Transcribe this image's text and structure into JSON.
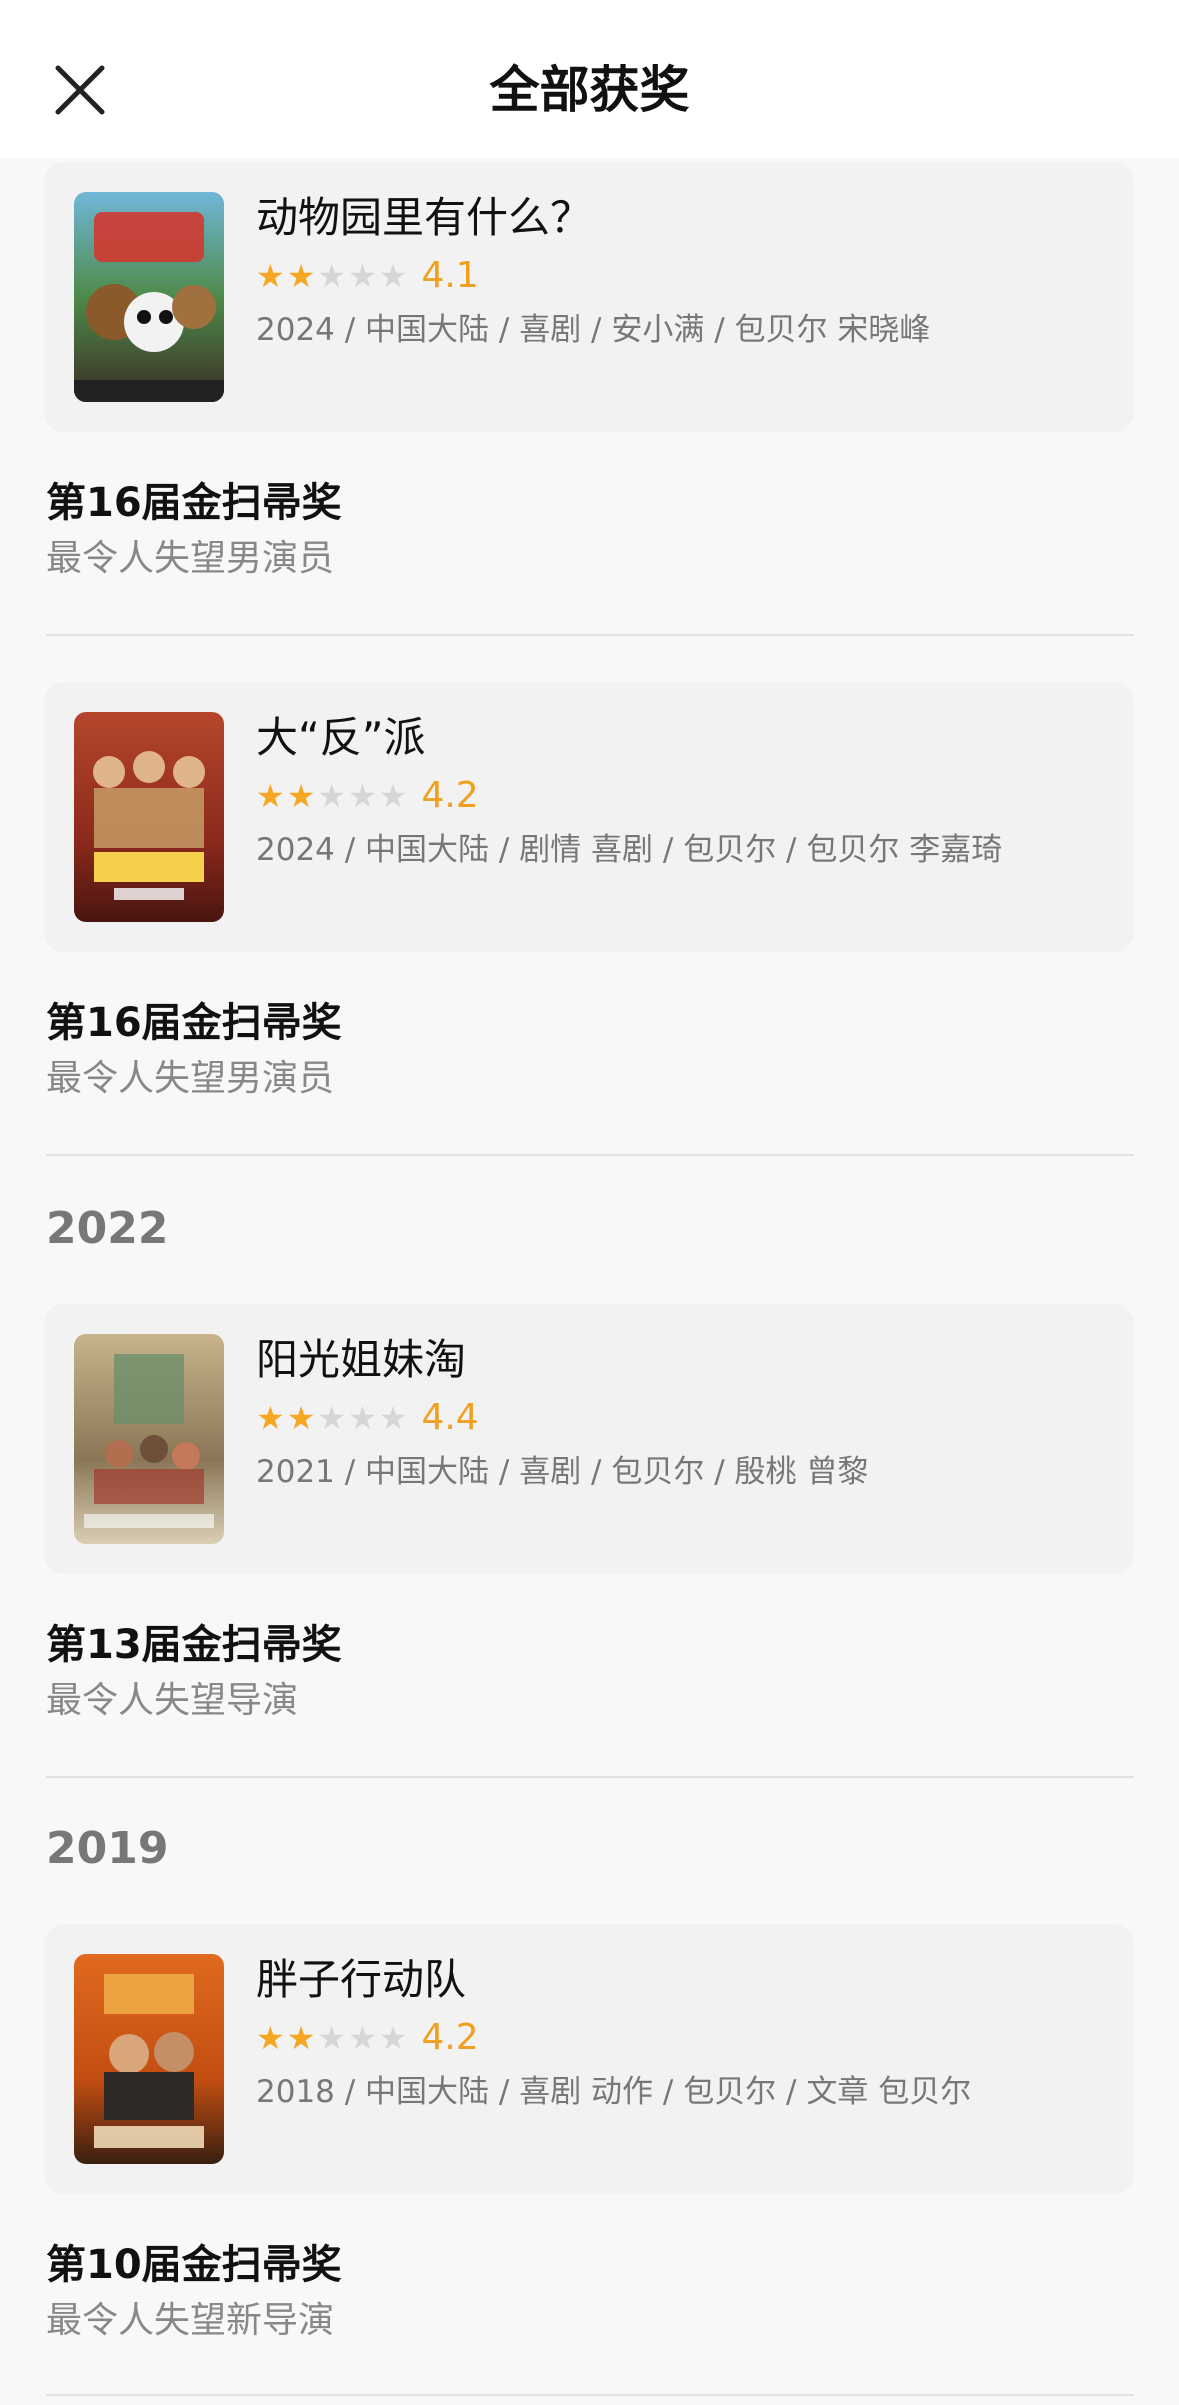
{
  "header": {
    "title": "全部获奖",
    "close_icon": "close-icon"
  },
  "colors": {
    "star_on": "#f5a623",
    "star_off": "#d6d6d6",
    "rating": "#f0a020"
  },
  "sections": [
    {
      "year": "",
      "movie": {
        "title": "动物园里有什么？",
        "stars_filled": 2,
        "stars_total": 5,
        "rating": "4.1",
        "meta": "2024 / 中国大陆 / 喜剧 / 安小满 / 包贝尔 宋晓峰"
      },
      "award": {
        "name": "第16届金扫帚奖",
        "category": "最令人失望男演员"
      }
    },
    {
      "year": "",
      "movie": {
        "title": "大“反”派",
        "stars_filled": 2,
        "stars_total": 5,
        "rating": "4.2",
        "meta": "2024 / 中国大陆 / 剧情 喜剧 / 包贝尔 / 包贝尔 李嘉琦"
      },
      "award": {
        "name": "第16届金扫帚奖",
        "category": "最令人失望男演员"
      }
    },
    {
      "year": "2022",
      "movie": {
        "title": "阳光姐妹淘",
        "stars_filled": 2,
        "stars_total": 5,
        "rating": "4.4",
        "meta": "2021 / 中国大陆 / 喜剧 / 包贝尔 / 殷桃 曾黎"
      },
      "award": {
        "name": "第13届金扫帚奖",
        "category": "最令人失望导演"
      }
    },
    {
      "year": "2019",
      "movie": {
        "title": "胖子行动队",
        "stars_filled": 2,
        "stars_total": 5,
        "rating": "4.2",
        "meta": "2018 / 中国大陆 / 喜剧 动作 / 包贝尔 / 文章 包贝尔"
      },
      "award": {
        "name": "第10届金扫帚奖",
        "category": "最令人失望新导演"
      }
    }
  ]
}
